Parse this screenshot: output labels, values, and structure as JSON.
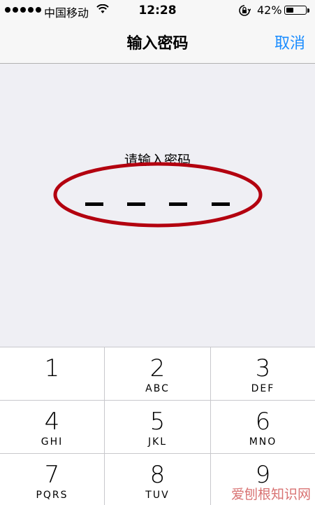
{
  "status_bar": {
    "carrier": "中国移动",
    "time": "12:28",
    "battery_percent": "42%",
    "battery_level": 0.42,
    "icons": [
      "signal-dots",
      "wifi-icon",
      "rotation-lock-icon",
      "battery-icon"
    ]
  },
  "nav": {
    "title": "输入密码",
    "cancel_label": "取消"
  },
  "main": {
    "prompt": "请输入密码"
  },
  "keypad": {
    "keys": [
      {
        "num": "1",
        "letters": ""
      },
      {
        "num": "2",
        "letters": "ABC"
      },
      {
        "num": "3",
        "letters": "DEF"
      },
      {
        "num": "4",
        "letters": "GHI"
      },
      {
        "num": "5",
        "letters": "JKL"
      },
      {
        "num": "6",
        "letters": "MNO"
      },
      {
        "num": "7",
        "letters": "PQRS"
      },
      {
        "num": "8",
        "letters": "TUV"
      },
      {
        "num": "9",
        "letters": ""
      }
    ]
  },
  "watermark": "爱刨根知识网",
  "colors": {
    "accent": "#1a8cff",
    "annotation": "#b3000f"
  }
}
